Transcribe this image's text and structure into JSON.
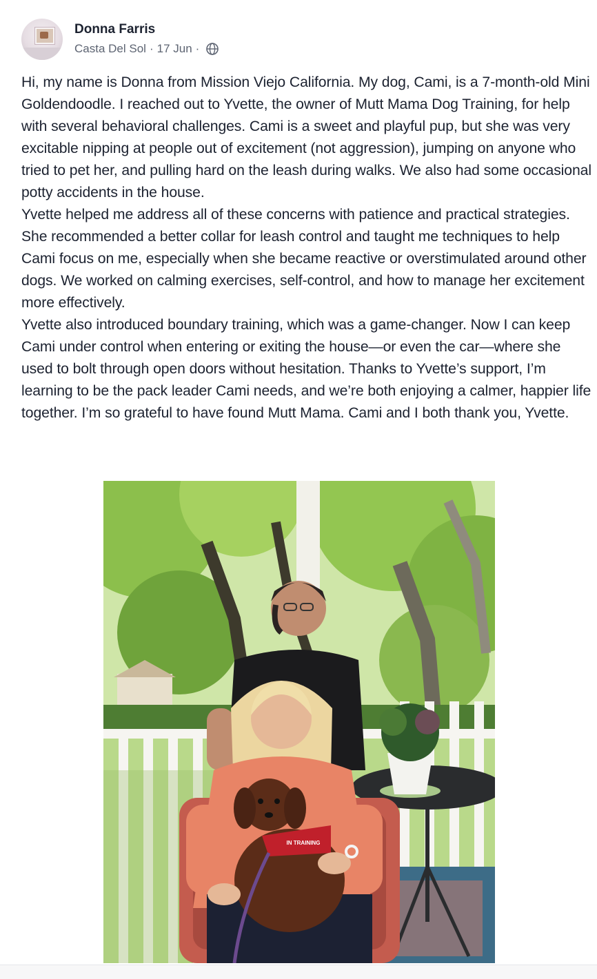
{
  "post": {
    "author": "Donna Farris",
    "group": "Casta Del Sol",
    "date": "17 Jun",
    "separator": "·",
    "visibility_icon": "globe-icon",
    "paragraphs": [
      "Hi, my name is Donna from Mission Viejo California. My dog, Cami, is a 7-month-old Mini Goldendoodle. I reached out to Yvette, the owner of Mutt Mama Dog Training, for help with several behavioral challenges. Cami is a sweet and playful pup, but she was very excitable nipping at people out of excitement (not aggression), jumping on anyone who tried to pet her, and pulling hard on the leash during walks. We also had some occasional potty accidents in the house.",
      "Yvette helped me address all of these concerns with patience and practical strategies. She recommended a better collar for leash control and taught me techniques to help Cami focus on me, especially when she became reactive or overstimulated around other dogs. We worked on calming exercises, self-control, and how to manage her excitement more effectively.",
      "Yvette also introduced boundary training, which was a game-changer. Now I can keep Cami under control when entering or exiting the house—or even the car—where she used to bolt through open doors without hesitation. Thanks to Yvette’s support, I’m learning to be the pack leader Cami needs, and we’re both enjoying a calmer, happier life together. I’m so grateful to have found Mutt Mama. Cami and I both thank you, Yvette."
    ],
    "photo_harness_text": "IN TRAINING"
  },
  "colors": {
    "text": "#1c2230",
    "secondary": "#5d6472",
    "background": "#ffffff"
  }
}
